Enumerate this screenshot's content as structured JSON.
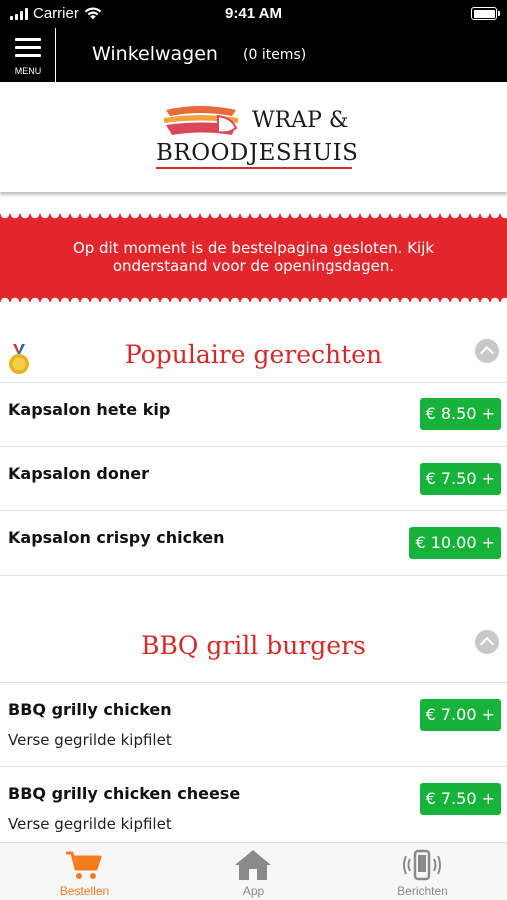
{
  "status_bar": {
    "carrier": "Carrier",
    "time": "9:41 AM"
  },
  "header": {
    "menu_label": "MENU",
    "title": "Winkelwagen",
    "item_count": "(0 items)"
  },
  "logo": {
    "line1": "WRAP &",
    "line2": "BROODJESHUIS"
  },
  "banner": {
    "text": "Op dit moment is de bestelpagina gesloten. Kijk onderstaand voor de openingsdagen."
  },
  "sections": [
    {
      "title": "Populaire gerechten",
      "items": [
        {
          "name": "Kapsalon hete kip",
          "price": "€ 8.50 +"
        },
        {
          "name": "Kapsalon doner",
          "price": "€ 7.50 +"
        },
        {
          "name": "Kapsalon crispy chicken",
          "price": "€ 10.00 +"
        }
      ]
    },
    {
      "title": "BBQ grill burgers",
      "items": [
        {
          "name": "BBQ grilly chicken",
          "desc": "Verse gegrilde kipfilet",
          "price": "€ 7.00 +"
        },
        {
          "name": "BBQ grilly chicken cheese",
          "desc": "Verse gegrilde kipfilet",
          "price": "€ 7.50 +"
        }
      ]
    }
  ],
  "tab_bar": {
    "tabs": [
      {
        "label": "Bestellen",
        "icon": "cart-icon",
        "active": true
      },
      {
        "label": "App",
        "icon": "home-icon",
        "active": false
      },
      {
        "label": "Berichten",
        "icon": "phone-vibrate-icon",
        "active": false
      }
    ]
  },
  "colors": {
    "accent_red": "#d42a2a",
    "banner_red": "#e3262b",
    "price_green": "#17b23a",
    "active_tab": "#f47c20",
    "inactive_tab": "#8a8a8a"
  }
}
